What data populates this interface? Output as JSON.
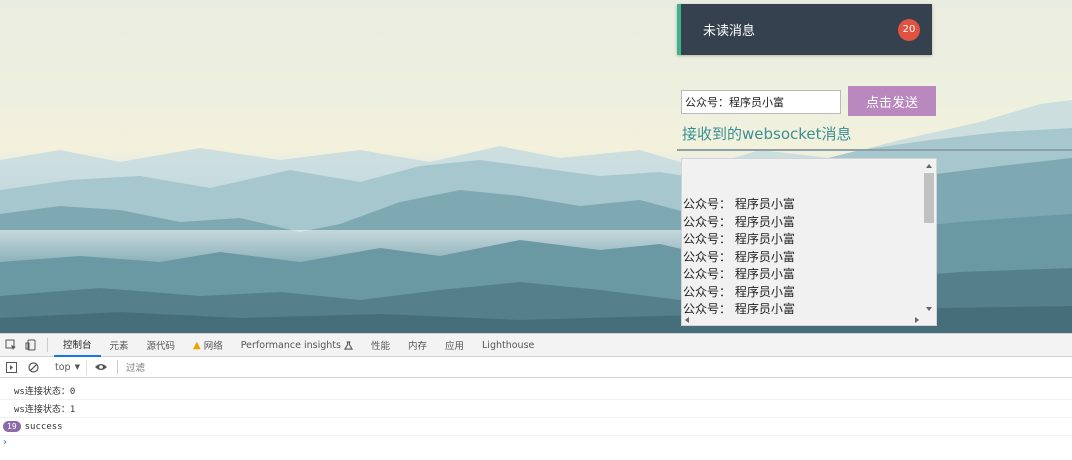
{
  "unread": {
    "label": "未读消息",
    "count": "20"
  },
  "form": {
    "input_value": "公众号：程序员小富",
    "send_label": "点击发送",
    "received_title": "接收到的websocket消息"
  },
  "messages": [
    "公众号：  程序员小富",
    "公众号：  程序员小富",
    "公众号：  程序员小富",
    "公众号：  程序员小富",
    "公众号：  程序员小富",
    "公众号：  程序员小富",
    "公众号：  程序员小富"
  ],
  "devtools": {
    "tabs": [
      "控制台",
      "元素",
      "源代码",
      "网络",
      "Performance insights",
      "性能",
      "内存",
      "应用",
      "Lighthouse"
    ],
    "active_tab": "控制台",
    "context": "top",
    "filter_placeholder": "过滤",
    "console_lines": [
      "ws连接状态：0",
      "ws连接状态：1"
    ],
    "success_count": "19",
    "success_text": "success",
    "prompt": "›"
  },
  "colors": {
    "card_bg": "#36414f",
    "card_accent": "#3fb28c",
    "badge": "#e25240",
    "send_button": "#b888bf",
    "title_text": "#3a8f95",
    "devtools_active": "#1a73e8"
  },
  "icons": [
    "inspect-icon",
    "device-toggle-icon",
    "warning-icon",
    "flask-icon",
    "sidebar-icon",
    "clear-icon",
    "dropdown-icon",
    "eye-icon"
  ]
}
